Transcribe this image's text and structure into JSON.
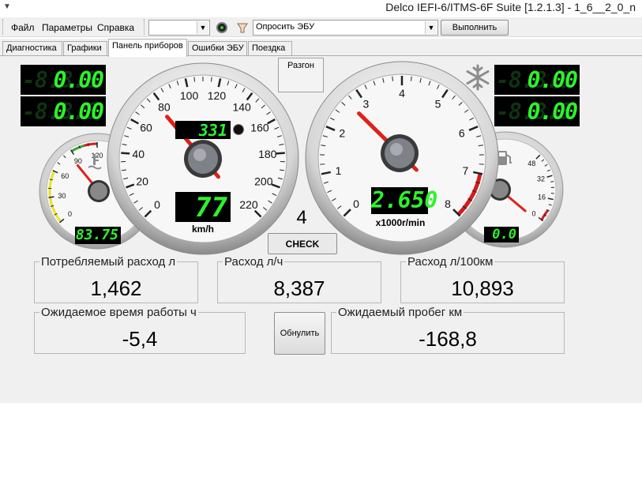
{
  "window": {
    "title": "Delco IEFI-6/ITMS-6F Suite [1.2.1.3] - 1_6__2_0_n"
  },
  "menu": {
    "items": [
      "Файл",
      "Параметры",
      "Справка"
    ]
  },
  "toolbar": {
    "port_combo_value": "",
    "request_combo_value": "Опросить ЭБУ",
    "execute_label": "Выполнить"
  },
  "tabs": [
    {
      "label": "Диагностика",
      "active": false
    },
    {
      "label": "Графики",
      "active": false
    },
    {
      "label": "Панель приборов",
      "active": true
    },
    {
      "label": "Ошибки ЭБУ",
      "active": false
    },
    {
      "label": "Поездка",
      "active": false
    }
  ],
  "left_lcd": {
    "ghost": "-8.8.8",
    "row1": "0.00",
    "row2": "0.00"
  },
  "right_lcd": {
    "ghost": "-8.8.8",
    "row1": "0.00",
    "row2": "0.00"
  },
  "speedometer": {
    "ticks": [
      "0",
      "20",
      "40",
      "60",
      "80",
      "100",
      "120",
      "140",
      "160",
      "180",
      "200",
      "220"
    ],
    "unit": "km/h",
    "odometer": "331",
    "speed_digital": "77",
    "needle_value": 77
  },
  "tachometer": {
    "ticks": [
      "0",
      "1",
      "2",
      "3",
      "4",
      "5",
      "6",
      "7",
      "8"
    ],
    "unit": "x1000r/min",
    "rpm_digital": "2.650",
    "needle_value": 2.65
  },
  "temp_gauge": {
    "ticks": [
      "0",
      "30",
      "60",
      "90",
      "120"
    ],
    "digital": "83.75",
    "needle_value": 83.75
  },
  "fuel_gauge": {
    "ticks": [
      "0",
      "16",
      "32",
      "48"
    ],
    "digital": "0.0",
    "needle_value": 0
  },
  "accel_button_label": "Разгон",
  "gear": "4",
  "check_label": "CHECK",
  "reset_button_label": "Обнулить",
  "stats": {
    "consumption_label": "Потребляемый расход л",
    "consumption_value": "1,462",
    "rate_label": "Расход л/ч",
    "rate_value": "8,387",
    "per100_label": "Расход л/100км",
    "per100_value": "10,893",
    "time_label": "Ожидаемое время работы ч",
    "time_value": "-5,4",
    "range_label": "Ожидаемый пробег км",
    "range_value": "-168,8"
  },
  "colors": {
    "lcd_green": "#2df22d",
    "needle_red": "#e0201a",
    "panel_bg": "#f0f0f0"
  },
  "icons": [
    "snowflake-icon",
    "coolant-temp-icon",
    "fuel-pump-icon",
    "record-icon",
    "settings-icon"
  ]
}
